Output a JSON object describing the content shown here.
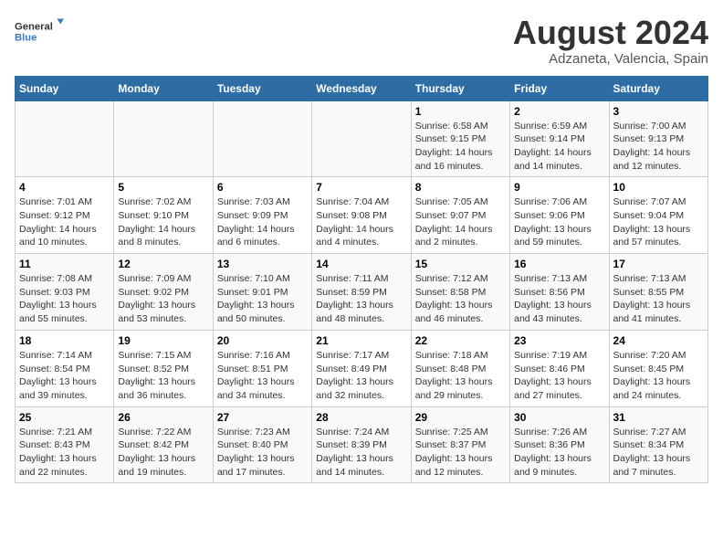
{
  "logo": {
    "general": "General",
    "blue": "Blue"
  },
  "title": "August 2024",
  "subtitle": "Adzaneta, Valencia, Spain",
  "headers": [
    "Sunday",
    "Monday",
    "Tuesday",
    "Wednesday",
    "Thursday",
    "Friday",
    "Saturday"
  ],
  "weeks": [
    [
      {
        "day": "",
        "info": ""
      },
      {
        "day": "",
        "info": ""
      },
      {
        "day": "",
        "info": ""
      },
      {
        "day": "",
        "info": ""
      },
      {
        "day": "1",
        "info": "Sunrise: 6:58 AM\nSunset: 9:15 PM\nDaylight: 14 hours\nand 16 minutes."
      },
      {
        "day": "2",
        "info": "Sunrise: 6:59 AM\nSunset: 9:14 PM\nDaylight: 14 hours\nand 14 minutes."
      },
      {
        "day": "3",
        "info": "Sunrise: 7:00 AM\nSunset: 9:13 PM\nDaylight: 14 hours\nand 12 minutes."
      }
    ],
    [
      {
        "day": "4",
        "info": "Sunrise: 7:01 AM\nSunset: 9:12 PM\nDaylight: 14 hours\nand 10 minutes."
      },
      {
        "day": "5",
        "info": "Sunrise: 7:02 AM\nSunset: 9:10 PM\nDaylight: 14 hours\nand 8 minutes."
      },
      {
        "day": "6",
        "info": "Sunrise: 7:03 AM\nSunset: 9:09 PM\nDaylight: 14 hours\nand 6 minutes."
      },
      {
        "day": "7",
        "info": "Sunrise: 7:04 AM\nSunset: 9:08 PM\nDaylight: 14 hours\nand 4 minutes."
      },
      {
        "day": "8",
        "info": "Sunrise: 7:05 AM\nSunset: 9:07 PM\nDaylight: 14 hours\nand 2 minutes."
      },
      {
        "day": "9",
        "info": "Sunrise: 7:06 AM\nSunset: 9:06 PM\nDaylight: 13 hours\nand 59 minutes."
      },
      {
        "day": "10",
        "info": "Sunrise: 7:07 AM\nSunset: 9:04 PM\nDaylight: 13 hours\nand 57 minutes."
      }
    ],
    [
      {
        "day": "11",
        "info": "Sunrise: 7:08 AM\nSunset: 9:03 PM\nDaylight: 13 hours\nand 55 minutes."
      },
      {
        "day": "12",
        "info": "Sunrise: 7:09 AM\nSunset: 9:02 PM\nDaylight: 13 hours\nand 53 minutes."
      },
      {
        "day": "13",
        "info": "Sunrise: 7:10 AM\nSunset: 9:01 PM\nDaylight: 13 hours\nand 50 minutes."
      },
      {
        "day": "14",
        "info": "Sunrise: 7:11 AM\nSunset: 8:59 PM\nDaylight: 13 hours\nand 48 minutes."
      },
      {
        "day": "15",
        "info": "Sunrise: 7:12 AM\nSunset: 8:58 PM\nDaylight: 13 hours\nand 46 minutes."
      },
      {
        "day": "16",
        "info": "Sunrise: 7:13 AM\nSunset: 8:56 PM\nDaylight: 13 hours\nand 43 minutes."
      },
      {
        "day": "17",
        "info": "Sunrise: 7:13 AM\nSunset: 8:55 PM\nDaylight: 13 hours\nand 41 minutes."
      }
    ],
    [
      {
        "day": "18",
        "info": "Sunrise: 7:14 AM\nSunset: 8:54 PM\nDaylight: 13 hours\nand 39 minutes."
      },
      {
        "day": "19",
        "info": "Sunrise: 7:15 AM\nSunset: 8:52 PM\nDaylight: 13 hours\nand 36 minutes."
      },
      {
        "day": "20",
        "info": "Sunrise: 7:16 AM\nSunset: 8:51 PM\nDaylight: 13 hours\nand 34 minutes."
      },
      {
        "day": "21",
        "info": "Sunrise: 7:17 AM\nSunset: 8:49 PM\nDaylight: 13 hours\nand 32 minutes."
      },
      {
        "day": "22",
        "info": "Sunrise: 7:18 AM\nSunset: 8:48 PM\nDaylight: 13 hours\nand 29 minutes."
      },
      {
        "day": "23",
        "info": "Sunrise: 7:19 AM\nSunset: 8:46 PM\nDaylight: 13 hours\nand 27 minutes."
      },
      {
        "day": "24",
        "info": "Sunrise: 7:20 AM\nSunset: 8:45 PM\nDaylight: 13 hours\nand 24 minutes."
      }
    ],
    [
      {
        "day": "25",
        "info": "Sunrise: 7:21 AM\nSunset: 8:43 PM\nDaylight: 13 hours\nand 22 minutes."
      },
      {
        "day": "26",
        "info": "Sunrise: 7:22 AM\nSunset: 8:42 PM\nDaylight: 13 hours\nand 19 minutes."
      },
      {
        "day": "27",
        "info": "Sunrise: 7:23 AM\nSunset: 8:40 PM\nDaylight: 13 hours\nand 17 minutes."
      },
      {
        "day": "28",
        "info": "Sunrise: 7:24 AM\nSunset: 8:39 PM\nDaylight: 13 hours\nand 14 minutes."
      },
      {
        "day": "29",
        "info": "Sunrise: 7:25 AM\nSunset: 8:37 PM\nDaylight: 13 hours\nand 12 minutes."
      },
      {
        "day": "30",
        "info": "Sunrise: 7:26 AM\nSunset: 8:36 PM\nDaylight: 13 hours\nand 9 minutes."
      },
      {
        "day": "31",
        "info": "Sunrise: 7:27 AM\nSunset: 8:34 PM\nDaylight: 13 hours\nand 7 minutes."
      }
    ]
  ]
}
